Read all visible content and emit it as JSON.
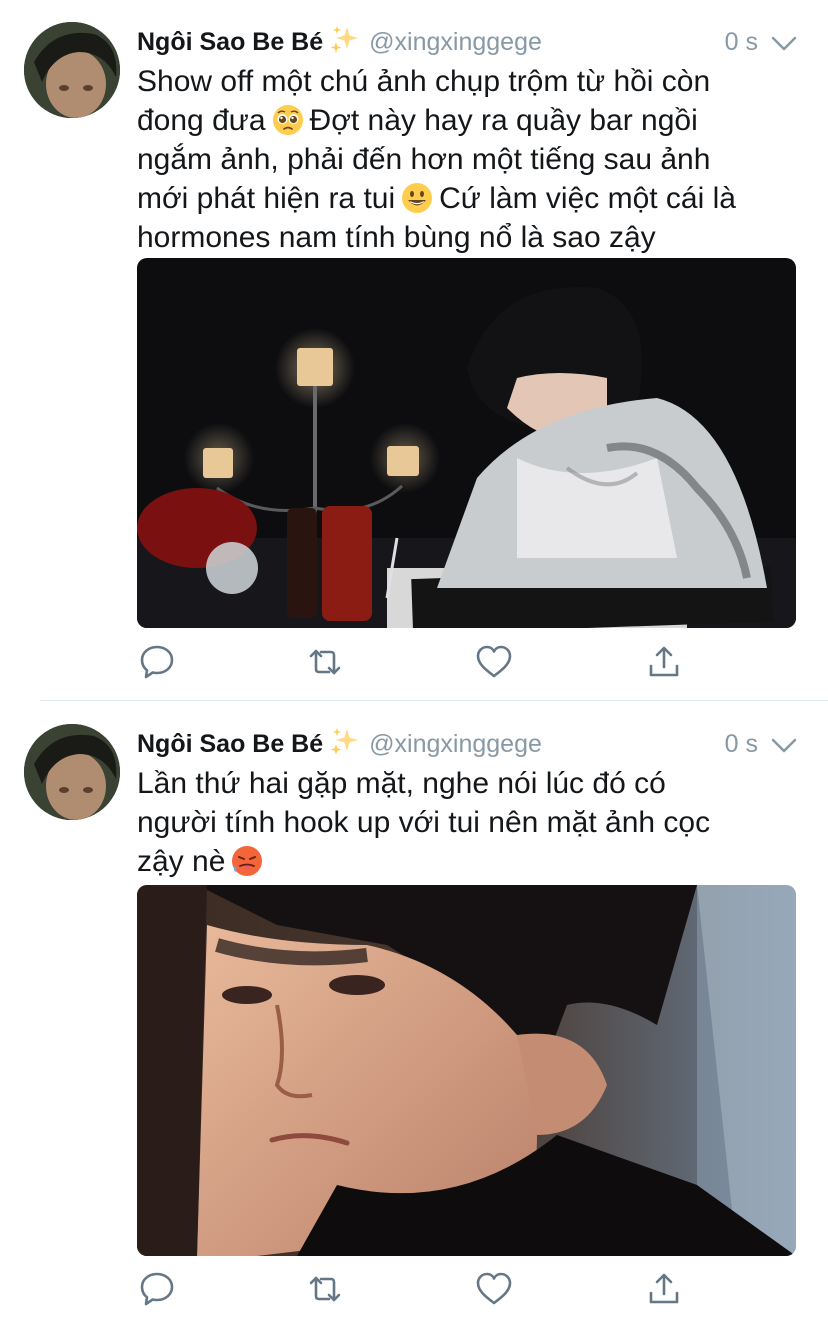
{
  "tweets": [
    {
      "author_name": "Ngôi Sao Be Bé",
      "author_handle": "@xingxinggege",
      "time": "0 s",
      "text_lines": [
        "Show off một chú ảnh chụp trộm từ hồi còn",
        "đong đưa",
        "Đợt này hay ra quầy bar ngồi",
        "ngắm ảnh, phải đến hơn một tiếng sau ảnh",
        "mới phát hiện ra tui",
        "Cứ làm việc một cái là",
        "hormones nam tính bùng nổ là sao zậy"
      ],
      "emojis": [
        "pleading-face-emoji",
        "grinning-face-emoji"
      ]
    },
    {
      "author_name": "Ngôi Sao Be Bé",
      "author_handle": "@xingxinggege",
      "time": "0 s",
      "text_lines": [
        "Lần thứ hai gặp mặt, nghe nói lúc đó có",
        "người tính hook up với tui nên mặt ảnh cọc",
        "zậy nè"
      ],
      "emojis": [
        "hot-face-emoji"
      ]
    }
  ],
  "icons": {
    "sparkle": "sparkles-icon",
    "reply": "reply-icon",
    "retweet": "retweet-icon",
    "like": "heart-icon",
    "share": "share-icon",
    "more": "chevron-down-icon"
  },
  "colors": {
    "text": "#14171a",
    "secondary": "#8899a6",
    "action_icon": "#657786",
    "divider": "#e1e8ed",
    "sparkle": "#ffd983"
  }
}
